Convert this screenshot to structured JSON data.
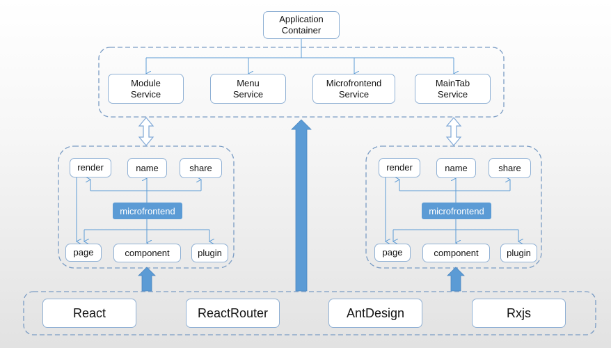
{
  "colors": {
    "line": "#5b9bd5",
    "dashed": "#7a9cc4",
    "box_border": "#8fb0d4",
    "accent": "#5b9bd5"
  },
  "app_container": {
    "label": "Application\nContainer"
  },
  "services": [
    {
      "label": "Module\nService"
    },
    {
      "label": "Menu\nService"
    },
    {
      "label": "Microfrontend\nService"
    },
    {
      "label": "MainTab\nService"
    }
  ],
  "micro_left": {
    "top": [
      "render",
      "name",
      "share"
    ],
    "center": "microfrontend",
    "bottom": [
      "page",
      "component",
      "plugin"
    ]
  },
  "micro_right": {
    "top": [
      "render",
      "name",
      "share"
    ],
    "center": "microfrontend",
    "bottom": [
      "page",
      "component",
      "plugin"
    ]
  },
  "foundation": [
    "React",
    "ReactRouter",
    "AntDesign",
    "Rxjs"
  ]
}
